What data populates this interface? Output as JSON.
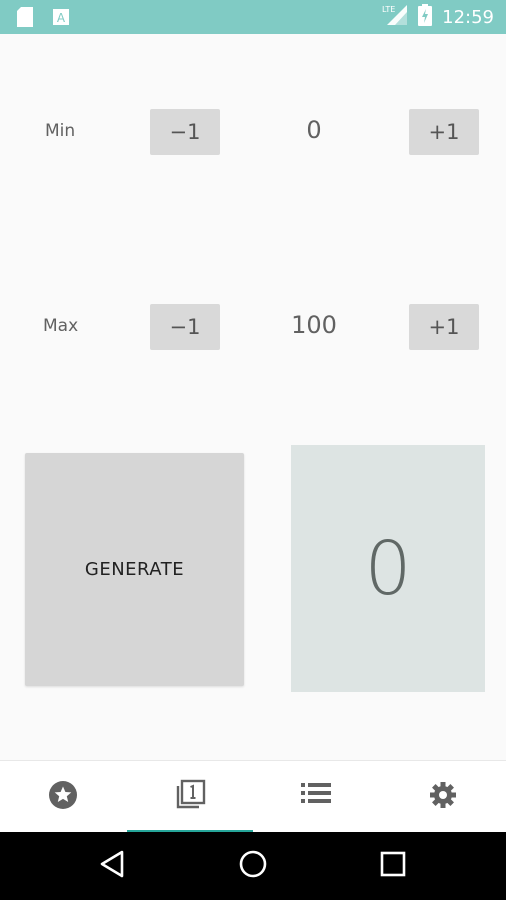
{
  "status_bar": {
    "time": "12:59",
    "icons": [
      "sd-card-icon",
      "keyboard-a-icon",
      "lte-signal-icon",
      "battery-charging-icon"
    ]
  },
  "min_row": {
    "label": "Min",
    "decrement_label": "−1",
    "value": "0",
    "increment_label": "+1"
  },
  "max_row": {
    "label": "Max",
    "decrement_label": "−1",
    "value": "100",
    "increment_label": "+1"
  },
  "generate": {
    "label": "GENERATE"
  },
  "result": {
    "value": "0"
  },
  "bottom_nav": {
    "items": [
      {
        "icon": "star-circle-icon",
        "selected": false
      },
      {
        "icon": "layers-one-icon",
        "selected": true
      },
      {
        "icon": "list-icon",
        "selected": false
      },
      {
        "icon": "gear-icon",
        "selected": false
      }
    ],
    "accent_color": "#26a69a"
  },
  "system_nav": {
    "buttons": [
      "back-icon",
      "home-icon",
      "recents-icon"
    ]
  },
  "colors": {
    "status_bar": "#80cbc4",
    "result_bg": "#dde4e3",
    "button_bg": "#d9d9d9"
  }
}
